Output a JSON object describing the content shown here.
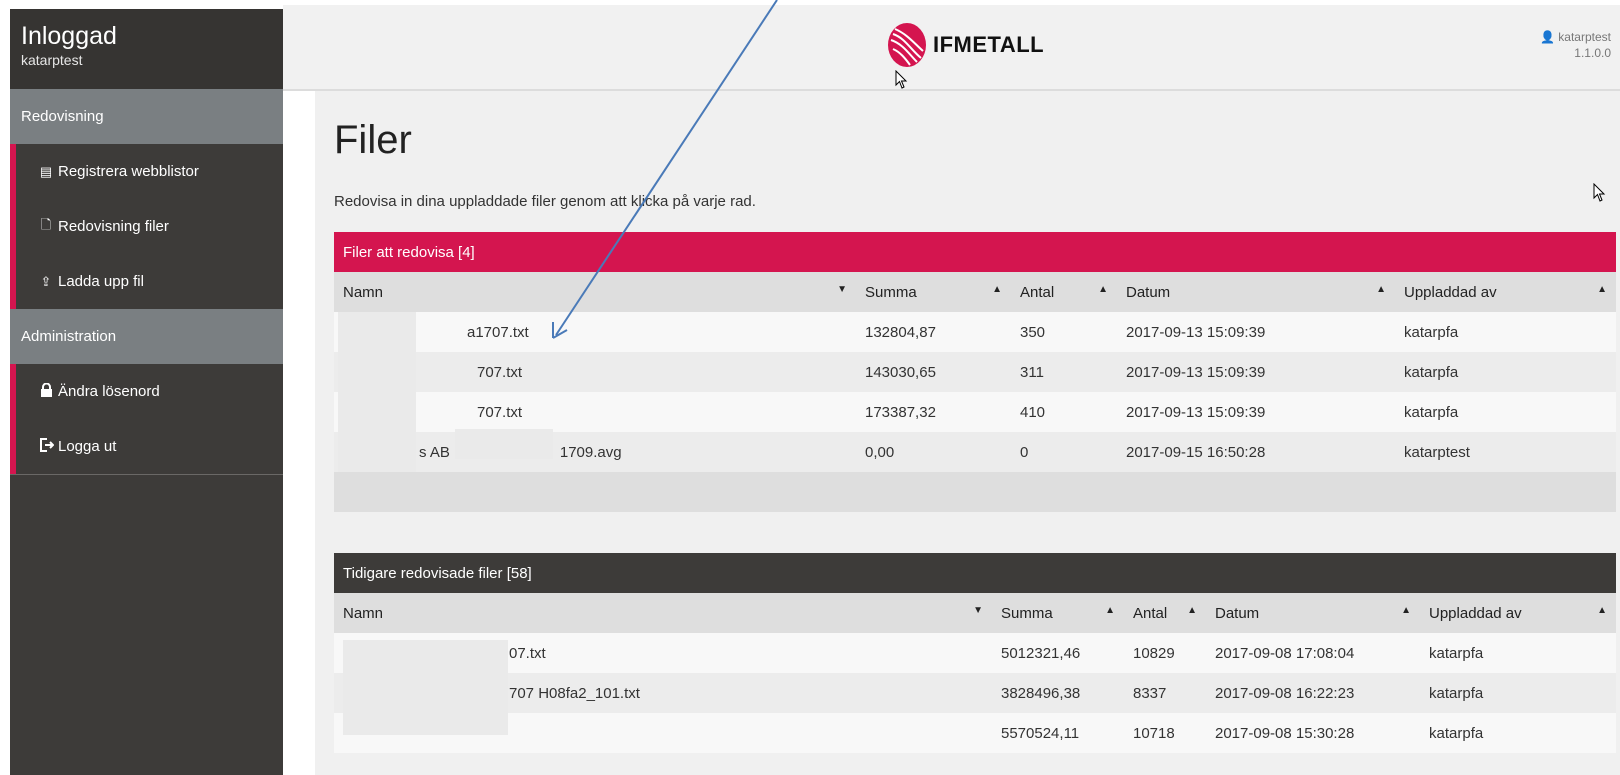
{
  "sidebar": {
    "title": "Inloggad",
    "user": "katarptest",
    "sections": [
      {
        "label": "Redovisning"
      },
      {
        "label": "Administration"
      }
    ],
    "items": [
      {
        "label": "Registrera webblistor",
        "icon": "list-icon"
      },
      {
        "label": "Redovisning filer",
        "icon": "file-icon"
      },
      {
        "label": "Ladda upp fil",
        "icon": "upload-icon"
      },
      {
        "label": "Ändra lösenord",
        "icon": "lock-icon"
      },
      {
        "label": "Logga ut",
        "icon": "logout-icon"
      }
    ]
  },
  "header": {
    "brand": "IFMETALL",
    "user": "katarptest",
    "version": "1.1.0.0"
  },
  "main": {
    "title": "Filer",
    "description": "Redovisa in dina uppladdade filer genom att klicka på varje rad."
  },
  "pending": {
    "title": "Filer att redovisa [4]",
    "columns": [
      "Namn",
      "Summa",
      "Antal",
      "Datum",
      "Uppladdad av"
    ],
    "rows": [
      {
        "name": "a1707.txt",
        "summa": "132804,87",
        "antal": "350",
        "datum": "2017-09-13 15:09:39",
        "by": "katarpfa"
      },
      {
        "name": "707.txt",
        "summa": "143030,65",
        "antal": "311",
        "datum": "2017-09-13 15:09:39",
        "by": "katarpfa"
      },
      {
        "name": "707.txt",
        "summa": "173387,32",
        "antal": "410",
        "datum": "2017-09-13 15:09:39",
        "by": "katarpfa"
      },
      {
        "name_part1": "s AB",
        "name_part2": "1709.avg",
        "summa": "0,00",
        "antal": "0",
        "datum": "2017-09-15 16:50:28",
        "by": "katarptest"
      }
    ]
  },
  "previous": {
    "title": "Tidigare redovisade filer [58]",
    "columns": [
      "Namn",
      "Summa",
      "Antal",
      "Datum",
      "Uppladdad av"
    ],
    "rows": [
      {
        "name": "07.txt",
        "summa": "5012321,46",
        "antal": "10829",
        "datum": "2017-09-08 17:08:04",
        "by": "katarpfa"
      },
      {
        "name": "707 H08fa2_101.txt",
        "summa": "3828496,38",
        "antal": "8337",
        "datum": "2017-09-08 16:22:23",
        "by": "katarpfa"
      },
      {
        "name": "",
        "summa": "5570524,11",
        "antal": "10718",
        "datum": "2017-09-08 15:30:28",
        "by": "katarpfa"
      }
    ]
  },
  "colors": {
    "accent": "#d4154f",
    "sidebar_bg": "#3d3b39",
    "section_bg": "#7a7f82",
    "annotation_arrow": "#4a7ab8"
  }
}
